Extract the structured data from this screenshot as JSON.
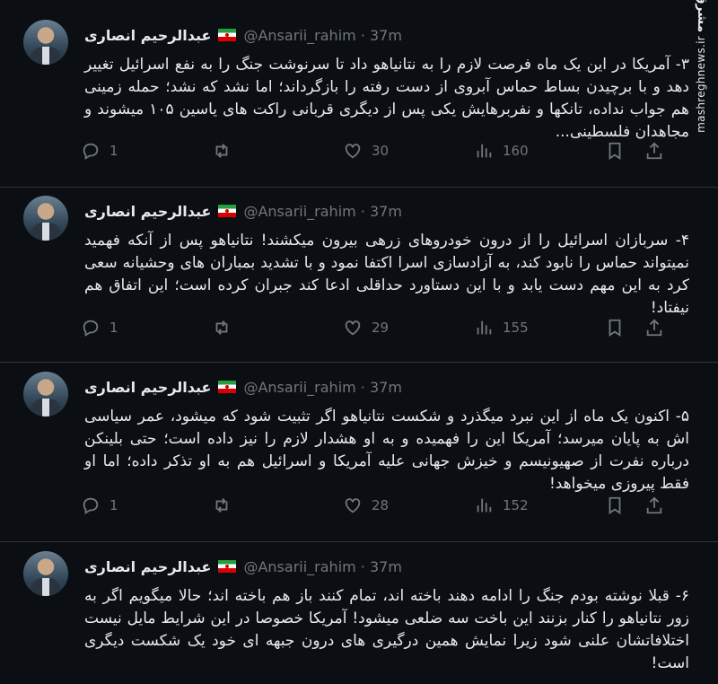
{
  "watermark": {
    "logo": "مشرق",
    "site": "mashreghnews.ir"
  },
  "tweets": [
    {
      "name": "عبدالرحیم انصاری",
      "handle": "@Ansarii_rahim · 37m",
      "text": "۳- آمریکا در این یک ماه فرصت لازم را به نتانیاهو داد تا سرنوشت جنگ را به نفع اسرائیل تغییر دهد و با برچیدن بساط حماس آبروی از دست رفته را بازگرداند؛ اما نشد که نشد؛ حمله زمینی هم جواب نداده، تانکها و نفربرهایش یکی پس از دیگری قربانی راکت های یاسین ۱۰۵ میشوند و مجاهدان فلسطینی...",
      "replies": "1",
      "likes": "30",
      "views": "160"
    },
    {
      "name": "عبدالرحیم انصاری",
      "handle": "@Ansarii_rahim · 37m",
      "text": "۴- سربازان اسرائیل را از درون خودروهای زرهی بیرون میکشند! نتانیاهو پس از آنکه فهمید نمیتواند حماس را نابود کند، به آزادسازی اسرا اکتفا نمود و با تشدید بمباران های وحشیانه سعی کرد به این مهم دست یابد و با این دستاورد حداقلی ادعا کند جبران کرده است؛ این اتفاق هم نیفتاد!",
      "replies": "1",
      "likes": "29",
      "views": "155"
    },
    {
      "name": "عبدالرحیم انصاری",
      "handle": "@Ansarii_rahim · 37m",
      "text": "۵- اکنون یک ماه از این نبرد میگذرد و شکست نتانیاهو اگر تثبیت شود که میشود، عمر سیاسی اش به پایان میرسد؛ آمریکا این را فهمیده و به او هشدار لازم را نیز داده است؛ حتی بلینکن درباره نفرت از صهیونیسم و خیزش جهانی علیه آمریکا و اسرائیل هم به او تذکر داده؛ اما او فقط پیروزی میخواهد!",
      "replies": "1",
      "likes": "28",
      "views": "152"
    },
    {
      "name": "عبدالرحیم انصاری",
      "handle": "@Ansarii_rahim · 37m",
      "text": "۶- قبلا نوشته بودم جنگ را ادامه دهند باخته اند، تمام کنند باز هم باخته اند؛ حالا میگویم اگر به زور نتانیاهو را کنار بزنند این باخت سه ضلعی میشود! آمریکا خصوصا در این شرایط مایل نیست اختلافاتشان علنی شود زیرا نمایش همین درگیری های درون جبهه ای خود یک شکست دیگری است!"
    }
  ]
}
